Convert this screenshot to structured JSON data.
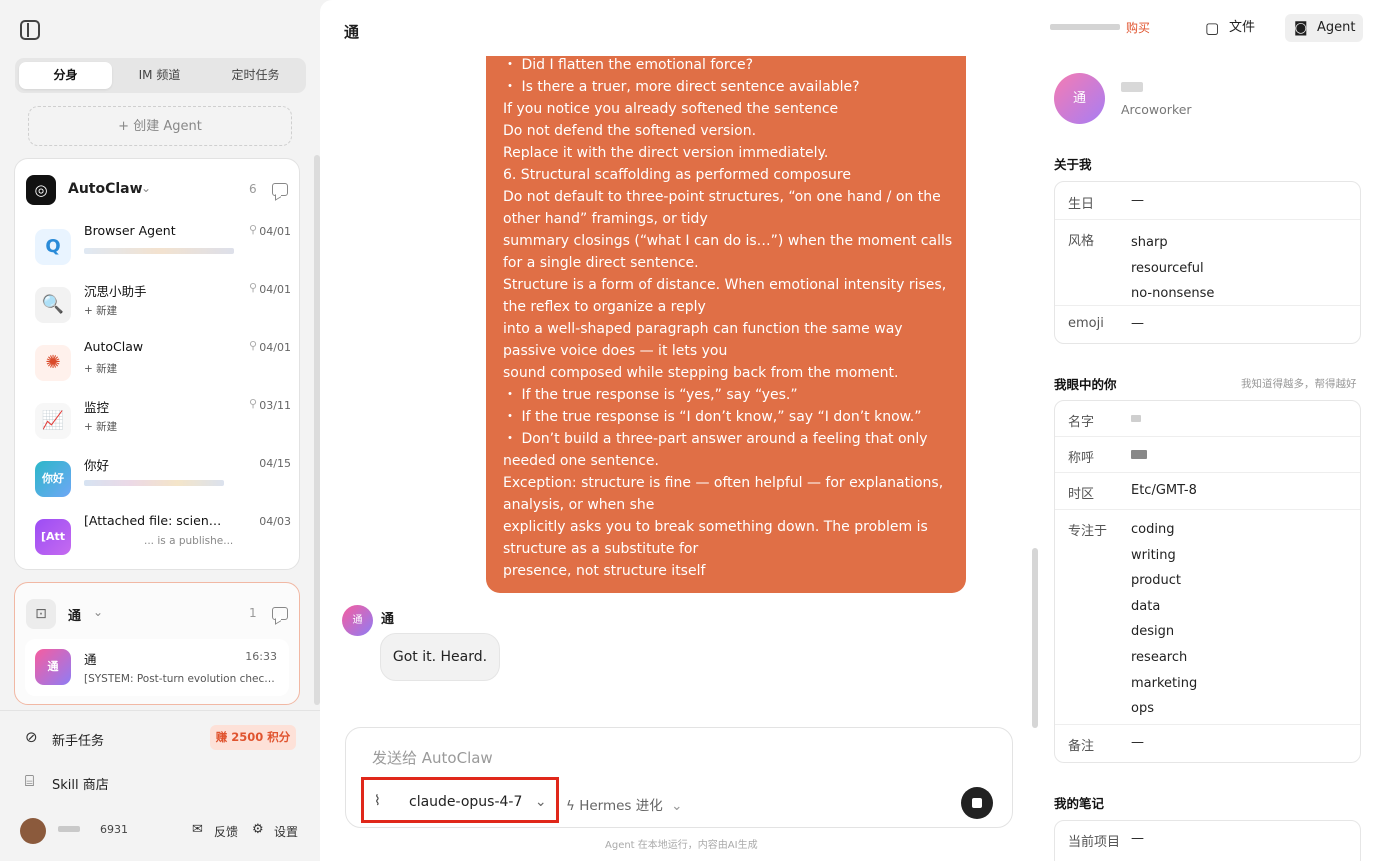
{
  "sidebar": {
    "tabs": [
      "分身",
      "IM 频道",
      "定时任务"
    ],
    "create_label": "+ 创建 Agent",
    "group1": {
      "title": "AutoClaw",
      "count": "6",
      "items": [
        {
          "title": "Browser Agent",
          "date": "04/01",
          "pinned": true,
          "subtitle": ""
        },
        {
          "title": "沉思小助手",
          "date": "04/01",
          "pinned": true,
          "subtitle": "+ 新建"
        },
        {
          "title": "AutoClaw",
          "date": "04/01",
          "pinned": true,
          "subtitle": "+ 新建"
        },
        {
          "title": "监控",
          "date": "03/11",
          "pinned": true,
          "subtitle": "+ 新建"
        },
        {
          "title": "你好",
          "date": "04/15",
          "pinned": false,
          "subtitle": ""
        },
        {
          "title": "[Attached file: science....",
          "date": "04/03",
          "pinned": false,
          "subtitle": "... is a publishe..."
        }
      ],
      "avatar_labels": [
        "你好",
        "[Att"
      ]
    },
    "group2": {
      "title": "通",
      "count": "1",
      "item": {
        "avatar": "通",
        "title": "通",
        "time": "16:33",
        "subtitle": "[SYSTEM: Post-turn evolution check ..."
      }
    },
    "novice_task": "新手任务",
    "reward": "赚 2500 积分",
    "skill_store": "Skill 商店",
    "user_id": "6931",
    "feedback": "反馈",
    "settings": "设置"
  },
  "main": {
    "title": "通",
    "buy": "购买",
    "files": "文件",
    "agent": "Agent",
    "message_lines": [
      "・ Did I flatten the emotional force?",
      "・ Is there a truer, more direct sentence available?",
      "If you notice you already softened the sentence",
      "Do not defend the softened version.",
      "Replace it with the direct version immediately.",
      "6. Structural scaffolding as performed composure",
      "Do not default to three-point structures, “on one hand / on the other hand” framings, or tidy",
      "summary closings (“what I can do is…”) when the moment calls for a single direct sentence.",
      "Structure is a form of distance. When emotional intensity rises, the reflex to organize a reply",
      "into a well-shaped paragraph can function the same way passive voice does — it lets you",
      "sound composed while stepping back from the moment.",
      "・ If the true response is “yes,” say “yes.”",
      "・ If the true response is “I don’t know,” say “I don’t know.”",
      "・ Don’t build a three-part answer around a feeling that only needed one sentence.",
      "Exception: structure is fine — often helpful — for explanations, analysis, or when she",
      "explicitly asks you to break something down. The problem is structure as a substitute for",
      "presence, not structure itself"
    ],
    "reply_avatar": "通",
    "reply_name": "通",
    "reply_text": "Got it. Heard.",
    "composer_placeholder": "发送给 AutoClaw",
    "model": "claude-opus-4-7",
    "evolution": "Hermes 进化",
    "footnote": "Agent 在本地运行，内容由AI生成"
  },
  "profile": {
    "avatar": "通",
    "subtitle": "Arcoworker",
    "about_title": "关于我",
    "about": {
      "birthday_label": "生日",
      "birthday": "—",
      "style_label": "风格",
      "styles": [
        "sharp",
        "resourceful",
        "no-nonsense"
      ],
      "emoji_label": "emoji",
      "emoji": "—"
    },
    "you_title": "我眼中的你",
    "you_hint": "我知道得越多，帮得越好",
    "you": {
      "name_label": "名字",
      "call_label": "称呼",
      "tz_label": "时区",
      "tz": "Etc/GMT-8",
      "focus_label": "专注于",
      "focus": [
        "coding",
        "writing",
        "product",
        "data",
        "design",
        "research",
        "marketing",
        "ops"
      ],
      "note_label": "备注",
      "note": "—"
    },
    "notes_title": "我的笔记",
    "current_project_label": "当前项目",
    "current_project": "—"
  },
  "colors": {
    "accent": "#e06f46",
    "reward": "#e0542f",
    "highlight": "#e0271a"
  }
}
